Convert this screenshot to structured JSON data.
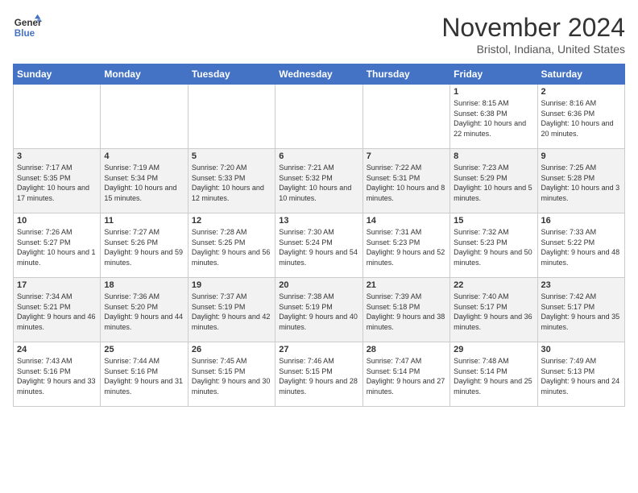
{
  "header": {
    "logo_line1": "General",
    "logo_line2": "Blue",
    "title": "November 2024",
    "subtitle": "Bristol, Indiana, United States"
  },
  "days_of_week": [
    "Sunday",
    "Monday",
    "Tuesday",
    "Wednesday",
    "Thursday",
    "Friday",
    "Saturday"
  ],
  "weeks": [
    [
      {
        "day": "",
        "info": ""
      },
      {
        "day": "",
        "info": ""
      },
      {
        "day": "",
        "info": ""
      },
      {
        "day": "",
        "info": ""
      },
      {
        "day": "",
        "info": ""
      },
      {
        "day": "1",
        "info": "Sunrise: 8:15 AM\nSunset: 6:38 PM\nDaylight: 10 hours and 22 minutes."
      },
      {
        "day": "2",
        "info": "Sunrise: 8:16 AM\nSunset: 6:36 PM\nDaylight: 10 hours and 20 minutes."
      }
    ],
    [
      {
        "day": "3",
        "info": "Sunrise: 7:17 AM\nSunset: 5:35 PM\nDaylight: 10 hours and 17 minutes."
      },
      {
        "day": "4",
        "info": "Sunrise: 7:19 AM\nSunset: 5:34 PM\nDaylight: 10 hours and 15 minutes."
      },
      {
        "day": "5",
        "info": "Sunrise: 7:20 AM\nSunset: 5:33 PM\nDaylight: 10 hours and 12 minutes."
      },
      {
        "day": "6",
        "info": "Sunrise: 7:21 AM\nSunset: 5:32 PM\nDaylight: 10 hours and 10 minutes."
      },
      {
        "day": "7",
        "info": "Sunrise: 7:22 AM\nSunset: 5:31 PM\nDaylight: 10 hours and 8 minutes."
      },
      {
        "day": "8",
        "info": "Sunrise: 7:23 AM\nSunset: 5:29 PM\nDaylight: 10 hours and 5 minutes."
      },
      {
        "day": "9",
        "info": "Sunrise: 7:25 AM\nSunset: 5:28 PM\nDaylight: 10 hours and 3 minutes."
      }
    ],
    [
      {
        "day": "10",
        "info": "Sunrise: 7:26 AM\nSunset: 5:27 PM\nDaylight: 10 hours and 1 minute."
      },
      {
        "day": "11",
        "info": "Sunrise: 7:27 AM\nSunset: 5:26 PM\nDaylight: 9 hours and 59 minutes."
      },
      {
        "day": "12",
        "info": "Sunrise: 7:28 AM\nSunset: 5:25 PM\nDaylight: 9 hours and 56 minutes."
      },
      {
        "day": "13",
        "info": "Sunrise: 7:30 AM\nSunset: 5:24 PM\nDaylight: 9 hours and 54 minutes."
      },
      {
        "day": "14",
        "info": "Sunrise: 7:31 AM\nSunset: 5:23 PM\nDaylight: 9 hours and 52 minutes."
      },
      {
        "day": "15",
        "info": "Sunrise: 7:32 AM\nSunset: 5:23 PM\nDaylight: 9 hours and 50 minutes."
      },
      {
        "day": "16",
        "info": "Sunrise: 7:33 AM\nSunset: 5:22 PM\nDaylight: 9 hours and 48 minutes."
      }
    ],
    [
      {
        "day": "17",
        "info": "Sunrise: 7:34 AM\nSunset: 5:21 PM\nDaylight: 9 hours and 46 minutes."
      },
      {
        "day": "18",
        "info": "Sunrise: 7:36 AM\nSunset: 5:20 PM\nDaylight: 9 hours and 44 minutes."
      },
      {
        "day": "19",
        "info": "Sunrise: 7:37 AM\nSunset: 5:19 PM\nDaylight: 9 hours and 42 minutes."
      },
      {
        "day": "20",
        "info": "Sunrise: 7:38 AM\nSunset: 5:19 PM\nDaylight: 9 hours and 40 minutes."
      },
      {
        "day": "21",
        "info": "Sunrise: 7:39 AM\nSunset: 5:18 PM\nDaylight: 9 hours and 38 minutes."
      },
      {
        "day": "22",
        "info": "Sunrise: 7:40 AM\nSunset: 5:17 PM\nDaylight: 9 hours and 36 minutes."
      },
      {
        "day": "23",
        "info": "Sunrise: 7:42 AM\nSunset: 5:17 PM\nDaylight: 9 hours and 35 minutes."
      }
    ],
    [
      {
        "day": "24",
        "info": "Sunrise: 7:43 AM\nSunset: 5:16 PM\nDaylight: 9 hours and 33 minutes."
      },
      {
        "day": "25",
        "info": "Sunrise: 7:44 AM\nSunset: 5:16 PM\nDaylight: 9 hours and 31 minutes."
      },
      {
        "day": "26",
        "info": "Sunrise: 7:45 AM\nSunset: 5:15 PM\nDaylight: 9 hours and 30 minutes."
      },
      {
        "day": "27",
        "info": "Sunrise: 7:46 AM\nSunset: 5:15 PM\nDaylight: 9 hours and 28 minutes."
      },
      {
        "day": "28",
        "info": "Sunrise: 7:47 AM\nSunset: 5:14 PM\nDaylight: 9 hours and 27 minutes."
      },
      {
        "day": "29",
        "info": "Sunrise: 7:48 AM\nSunset: 5:14 PM\nDaylight: 9 hours and 25 minutes."
      },
      {
        "day": "30",
        "info": "Sunrise: 7:49 AM\nSunset: 5:13 PM\nDaylight: 9 hours and 24 minutes."
      }
    ]
  ]
}
